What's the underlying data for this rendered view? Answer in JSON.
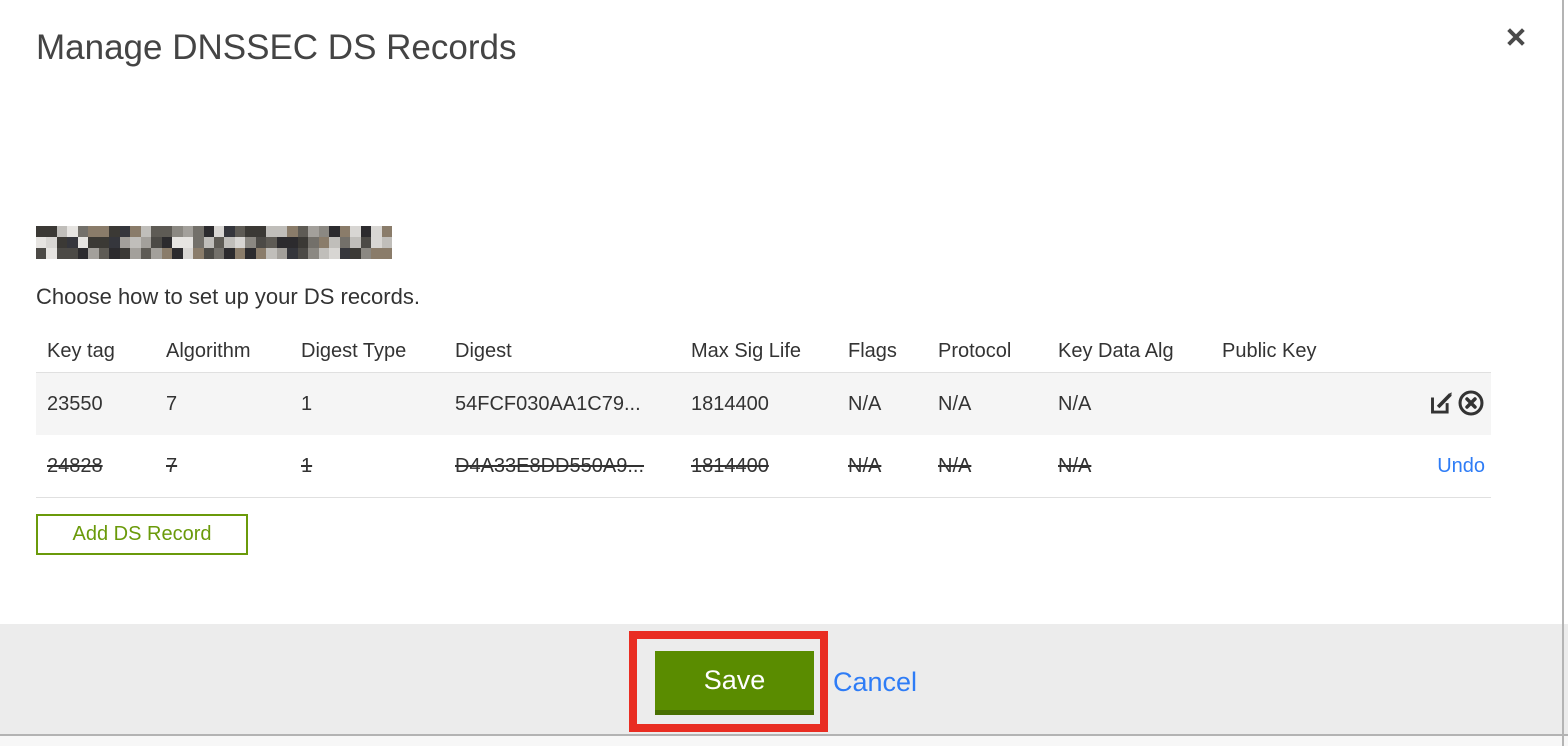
{
  "modal": {
    "title": "Manage DNSSEC DS Records",
    "subtitle": "Choose how to set up your DS records."
  },
  "table": {
    "headers": {
      "key_tag": "Key tag",
      "algorithm": "Algorithm",
      "digest_type": "Digest Type",
      "digest": "Digest",
      "max_sig_life": "Max Sig Life",
      "flags": "Flags",
      "protocol": "Protocol",
      "key_data_alg": "Key Data Alg",
      "public_key": "Public Key"
    },
    "rows": [
      {
        "key_tag": "23550",
        "algorithm": "7",
        "digest_type": "1",
        "digest": "54FCF030AA1C79...",
        "max_sig_life": "1814400",
        "flags": "N/A",
        "protocol": "N/A",
        "key_data_alg": "N/A",
        "public_key": "",
        "state": "active"
      },
      {
        "key_tag": "24828",
        "algorithm": "7",
        "digest_type": "1",
        "digest": "D4A33E8DD550A9...",
        "max_sig_life": "1814400",
        "flags": "N/A",
        "protocol": "N/A",
        "key_data_alg": "N/A",
        "public_key": "",
        "state": "marked-for-deletion",
        "undo_label": "Undo"
      }
    ]
  },
  "actions": {
    "add_ds_record": "Add DS Record",
    "save": "Save",
    "cancel": "Cancel"
  },
  "colors": {
    "button_green": "#5a8c00",
    "outline_green": "#6a9a0a",
    "link_blue": "#2e7cf6",
    "annotation_red": "#e92d22",
    "footer_gray": "#ececec"
  }
}
